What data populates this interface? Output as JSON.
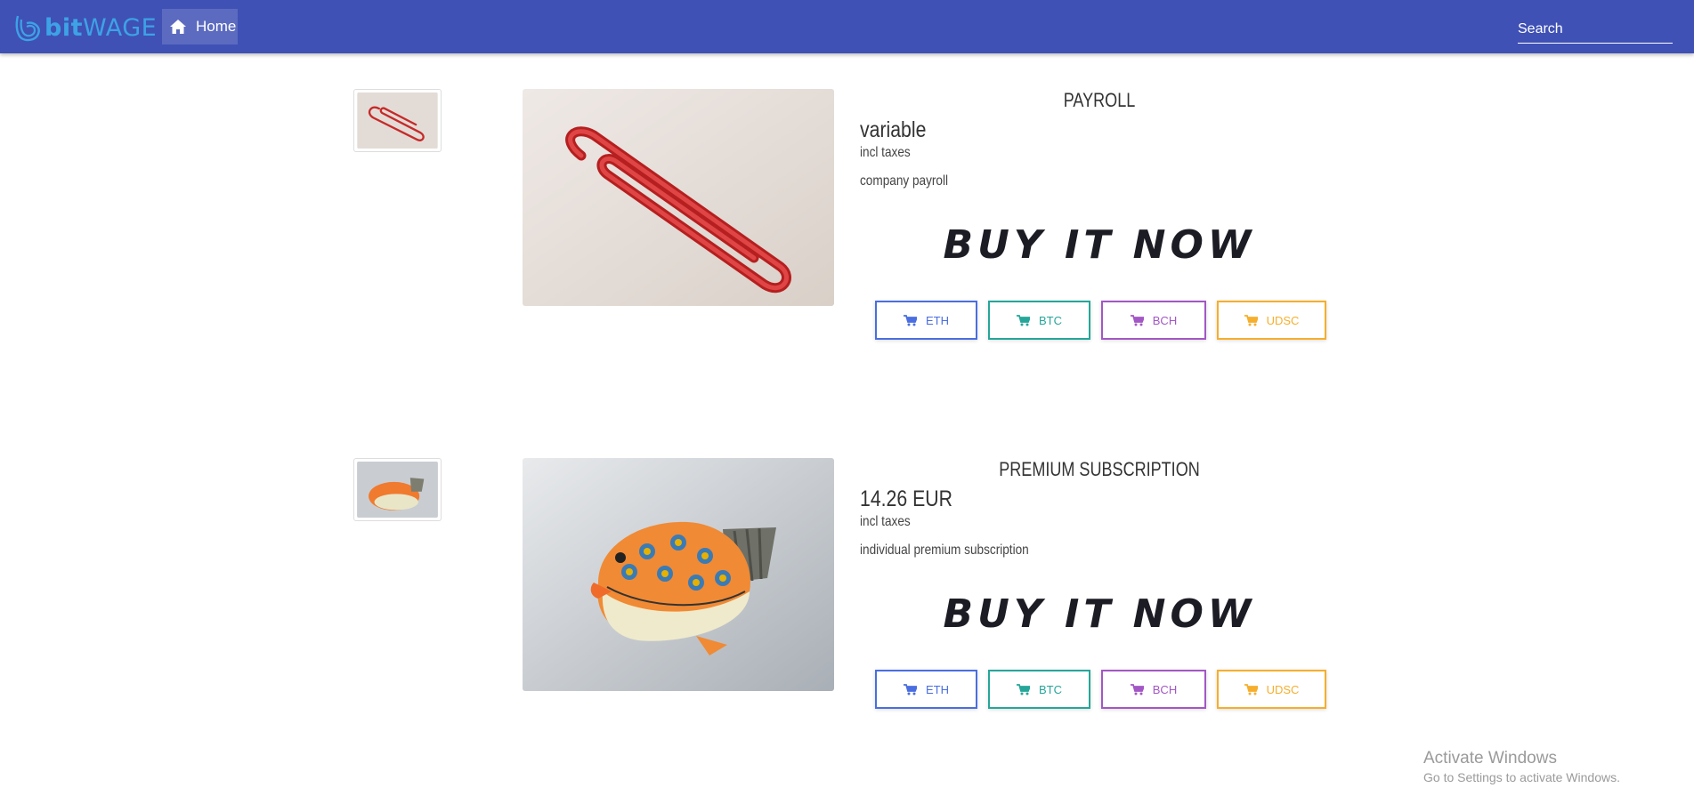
{
  "brand": {
    "bit": "bit",
    "wage": "WAGE"
  },
  "nav": {
    "home_label": "Home",
    "search_placeholder": "Search"
  },
  "products": [
    {
      "title": "PAYROLL",
      "price": "variable",
      "tax_note": "incl taxes",
      "description": "company payroll",
      "buy_label": "BUY IT NOW",
      "image": "red-paperclip",
      "buttons": {
        "eth": "ETH",
        "btc": "BTC",
        "bch": "BCH",
        "usdc": "UDSC"
      }
    },
    {
      "title": "PREMIUM SUBSCRIPTION",
      "price": "14.26 EUR",
      "tax_note": "incl taxes",
      "description": "individual premium subscription",
      "buy_label": "BUY IT NOW",
      "image": "orange-fish-figurine",
      "buttons": {
        "eth": "ETH",
        "btc": "BTC",
        "bch": "BCH",
        "usdc": "UDSC"
      }
    }
  ],
  "watermark": {
    "line1": "Activate Windows",
    "line2": "Go to Settings to activate Windows."
  },
  "colors": {
    "navbar": "#3f51b5",
    "eth": "#4a6ee0",
    "btc": "#26a69a",
    "bch": "#a357c5",
    "usdc": "#f6ae2d"
  }
}
